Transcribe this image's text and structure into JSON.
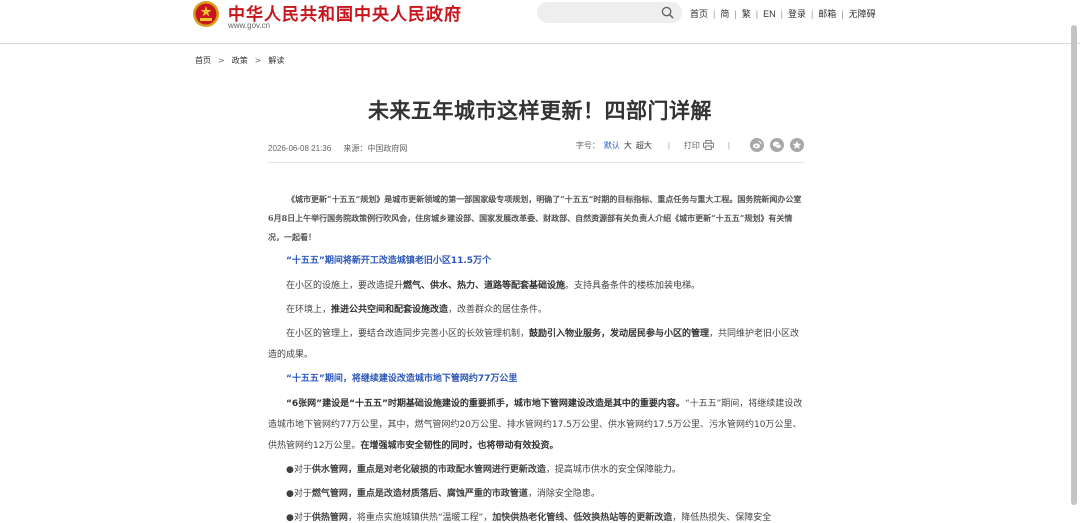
{
  "header": {
    "site_name": "中华人民共和国中央人民政府",
    "site_url": "www.gov.cn",
    "search": {
      "placeholder": ""
    },
    "nav": [
      "首页",
      "简",
      "繁",
      "EN",
      "登录",
      "邮箱",
      "无障碍"
    ]
  },
  "breadcrumb": [
    "首页",
    "政策",
    "解读"
  ],
  "article": {
    "title": "未来五年城市这样更新！四部门详解",
    "datetime": "2026-06-08 21:36",
    "source_label": "来源：",
    "source": "中国政府网",
    "font_size": {
      "label": "字号：",
      "options": [
        "默认",
        "大",
        "超大"
      ],
      "selected": "默认"
    },
    "print_label": "打印",
    "share": [
      "weibo-icon",
      "wechat-icon",
      "qzone-icon"
    ],
    "intro": "《城市更新“十五五”规划》是城市更新领域的第一部国家级专项规划，明确了“十五五”时期的目标指标、重点任务与重大工程。国务院新闻办公室6月8日上午举行国务院政策例行吹风会，住房城乡建设部、国家发展改革委、财政部、自然资源部有关负责人介绍《城市更新“十五五”规划》有关情况，一起看！",
    "section1": {
      "heading": "“十五五”期间将新开工改造城镇老旧小区11.5万个",
      "p1": {
        "a": "在小区的设施上，要改造提升",
        "b": "燃气、供水、热力、道路等配套基础设施",
        "c": "。支持具备条件的楼栋加装电梯。"
      },
      "p2": {
        "a": "在环境上，",
        "b": "推进公共空间和配套设施改造",
        "c": "，改善群众的居住条件。"
      },
      "p3": {
        "a": "在小区的管理上，要结合改造同步完善小区的长效管理机制，",
        "b": "鼓励引入物业服务，发动居民参与小区的管理",
        "c": "，共同维护老旧小区改造的成果。"
      }
    },
    "section2": {
      "heading": "“十五五”期间，将继续建设改造城市地下管网约77万公里",
      "p1": {
        "a": "“6张网”建设是“十五五”时期基础设施建设的重要抓手，城市地下管网建设改造是其中的重要内容。",
        "b": "“十五五”期间，将继续建设改造城市地下管网约77万公里，其中，燃气管网约20万公里、排水管网约17.5万公里、供水管网约17.5万公里、污水管网约10万公里、供热管网约12万公里。",
        "c": "在增强城市安全韧性的同时，也将带动有效投资。"
      },
      "bullets": [
        {
          "a": "●对于",
          "b": "供水管网，重点是对老化破损的市政配水管网进行更新改造",
          "c": "，提高城市供水的安全保障能力。"
        },
        {
          "a": "●对于",
          "b": "燃气管网，重点是改造材质落后、腐蚀严重的市政管道",
          "c": "，消除安全隐患。"
        },
        {
          "a": "●对于",
          "b": "供热管网",
          "c": "，将重点实施城镇供热“温暖工程”，",
          "d": "加快供热老化管线、低效换热站等的更新改造",
          "e": "，降低热损失、保障安全"
        }
      ]
    }
  },
  "colors": {
    "brand_red": "#c8161d",
    "accent_blue": "#2e59b8"
  }
}
